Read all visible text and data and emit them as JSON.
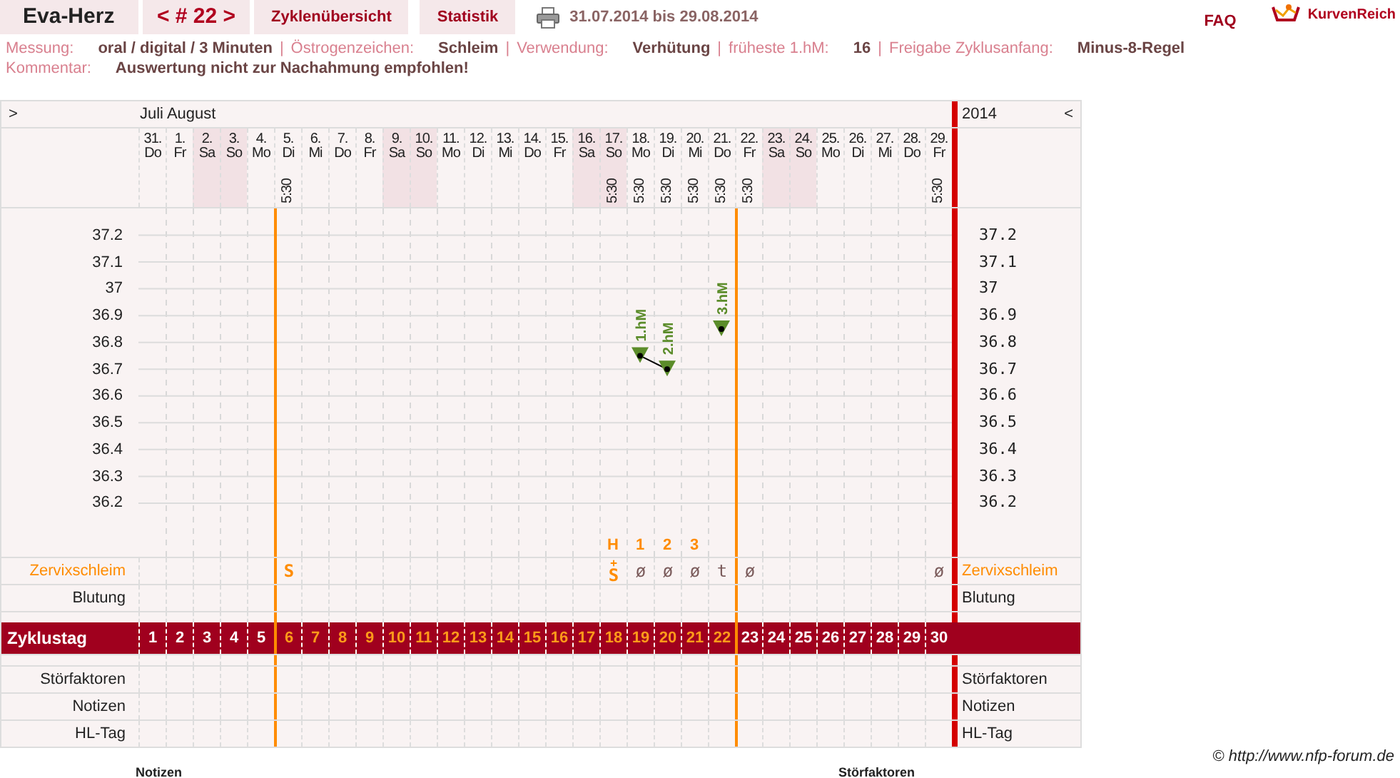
{
  "header": {
    "title": "Eva-Herz",
    "cycle": "< # 22 >",
    "tabs": [
      {
        "label": "Zyklenübersicht"
      },
      {
        "label": "Statistik"
      }
    ],
    "date_range": "31.07.2014 bis 29.08.2014",
    "faq": "FAQ",
    "brand": "KurvenReich"
  },
  "info": [
    [
      {
        "label": "Messung:",
        "value": "oral / digital / 3 Minuten",
        "separator": "|"
      },
      {
        "label": "Östrogenzeichen:",
        "value": "Schleim",
        "separator": "|"
      },
      {
        "label": "Verwendung:",
        "value": "Verhütung",
        "separator": "|"
      },
      {
        "label": "früheste 1.hM:",
        "value": "16",
        "separator": "|"
      },
      {
        "label": "Freigabe Zyklusanfang:",
        "value": "Minus-8-Regel"
      }
    ],
    [
      {
        "label": "Kommentar:",
        "value": "Auswertung nicht zur Nachahmung empfohlen!"
      }
    ]
  ],
  "table": {
    "nav_left": ">",
    "months": "Juli August",
    "year": "2014",
    "nav_right": "<",
    "days": [
      {
        "date": "31.",
        "weekday": "Do",
        "weekend": false,
        "cycle_day": "1",
        "fertile": false,
        "phase_line": false
      },
      {
        "date": "1.",
        "weekday": "Fr",
        "weekend": false,
        "cycle_day": "2",
        "fertile": false,
        "phase_line": false
      },
      {
        "date": "2.",
        "weekday": "Sa",
        "weekend": true,
        "cycle_day": "3",
        "fertile": false,
        "phase_line": false
      },
      {
        "date": "3.",
        "weekday": "So",
        "weekend": true,
        "cycle_day": "4",
        "fertile": false,
        "phase_line": false
      },
      {
        "date": "4.",
        "weekday": "Mo",
        "weekend": false,
        "cycle_day": "5",
        "fertile": false,
        "phase_line": false
      },
      {
        "date": "5.",
        "weekday": "Di",
        "weekend": false,
        "time": "5:30",
        "cycle_day": "6",
        "fertile": true,
        "phase_line": true,
        "mucus": "S",
        "mucus_fertile": true
      },
      {
        "date": "6.",
        "weekday": "Mi",
        "weekend": false,
        "cycle_day": "7",
        "fertile": true,
        "phase_line": false
      },
      {
        "date": "7.",
        "weekday": "Do",
        "weekend": false,
        "cycle_day": "8",
        "fertile": true,
        "phase_line": false
      },
      {
        "date": "8.",
        "weekday": "Fr",
        "weekend": false,
        "cycle_day": "9",
        "fertile": true,
        "phase_line": false
      },
      {
        "date": "9.",
        "weekday": "Sa",
        "weekend": true,
        "cycle_day": "10",
        "fertile": true,
        "phase_line": false
      },
      {
        "date": "10.",
        "weekday": "So",
        "weekend": true,
        "cycle_day": "11",
        "fertile": true,
        "phase_line": false
      },
      {
        "date": "11.",
        "weekday": "Mo",
        "weekend": false,
        "cycle_day": "12",
        "fertile": true,
        "phase_line": false
      },
      {
        "date": "12.",
        "weekday": "Di",
        "weekend": false,
        "cycle_day": "13",
        "fertile": true,
        "phase_line": false
      },
      {
        "date": "13.",
        "weekday": "Mi",
        "weekend": false,
        "cycle_day": "14",
        "fertile": true,
        "phase_line": false
      },
      {
        "date": "14.",
        "weekday": "Do",
        "weekend": false,
        "cycle_day": "15",
        "fertile": true,
        "phase_line": false
      },
      {
        "date": "15.",
        "weekday": "Fr",
        "weekend": false,
        "cycle_day": "16",
        "fertile": true,
        "phase_line": false
      },
      {
        "date": "16.",
        "weekday": "Sa",
        "weekend": true,
        "cycle_day": "17",
        "fertile": true,
        "phase_line": false
      },
      {
        "date": "17.",
        "weekday": "So",
        "weekend": true,
        "time": "5:30",
        "cycle_day": "18",
        "fertile": true,
        "phase_line": false,
        "count_mark": "H",
        "mucus": "S",
        "mucus_note": "+",
        "mucus_fertile": true
      },
      {
        "date": "18.",
        "weekday": "Mo",
        "weekend": false,
        "time": "5:30",
        "cycle_day": "19",
        "fertile": true,
        "phase_line": false,
        "count_mark": "1",
        "mucus": "ø",
        "mucus_fertile": false,
        "temp_label": "1.hM"
      },
      {
        "date": "19.",
        "weekday": "Di",
        "weekend": false,
        "time": "5:30",
        "cycle_day": "20",
        "fertile": true,
        "phase_line": false,
        "count_mark": "2",
        "mucus": "ø",
        "mucus_fertile": false,
        "temp_label": "2.hM"
      },
      {
        "date": "20.",
        "weekday": "Mi",
        "weekend": false,
        "time": "5:30",
        "cycle_day": "21",
        "fertile": true,
        "phase_line": false,
        "count_mark": "3",
        "mucus": "ø",
        "mucus_fertile": false
      },
      {
        "date": "21.",
        "weekday": "Do",
        "weekend": false,
        "time": "5:30",
        "cycle_day": "22",
        "fertile": true,
        "phase_line": false,
        "mucus": "t",
        "mucus_fertile": false,
        "temp_label": "3.hM"
      },
      {
        "date": "22.",
        "weekday": "Fr",
        "weekend": false,
        "time": "5:30",
        "cycle_day": "23",
        "fertile": false,
        "phase_line": true,
        "mucus": "ø",
        "mucus_fertile": false
      },
      {
        "date": "23.",
        "weekday": "Sa",
        "weekend": true,
        "cycle_day": "24",
        "fertile": false,
        "phase_line": false
      },
      {
        "date": "24.",
        "weekday": "So",
        "weekend": true,
        "cycle_day": "25",
        "fertile": false,
        "phase_line": false
      },
      {
        "date": "25.",
        "weekday": "Mo",
        "weekend": false,
        "cycle_day": "26",
        "fertile": false,
        "phase_line": false
      },
      {
        "date": "26.",
        "weekday": "Di",
        "weekend": false,
        "cycle_day": "27",
        "fertile": false,
        "phase_line": false
      },
      {
        "date": "27.",
        "weekday": "Mi",
        "weekend": false,
        "cycle_day": "28",
        "fertile": false,
        "phase_line": false
      },
      {
        "date": "28.",
        "weekday": "Do",
        "weekend": false,
        "cycle_day": "29",
        "fertile": false,
        "phase_line": false
      },
      {
        "date": "29.",
        "weekday": "Fr",
        "weekend": false,
        "time": "5:30",
        "cycle_day": "30",
        "fertile": false,
        "phase_line": false,
        "mucus": "ø",
        "mucus_fertile": false
      }
    ],
    "chart_data": {
      "type": "line",
      "series": [
        {
          "marker": "triangle_down",
          "color": "#5b8c2a",
          "values": [
            null,
            null,
            null,
            null,
            null,
            null,
            null,
            null,
            null,
            null,
            null,
            null,
            null,
            null,
            null,
            null,
            null,
            null,
            36.75,
            36.7,
            null,
            36.85,
            null,
            null,
            null,
            null,
            null,
            null,
            null,
            null
          ]
        }
      ],
      "ylim": [
        36.0,
        37.3
      ],
      "grid": true,
      "yticks": [
        {
          "value": 37.2,
          "label": "37.2"
        },
        {
          "value": 37.1,
          "label": "37.1"
        },
        {
          "value": 37,
          "label": "37"
        },
        {
          "value": 36.9,
          "label": "36.9"
        },
        {
          "value": 36.8,
          "label": "36.8"
        },
        {
          "value": 36.7,
          "label": "36.7"
        },
        {
          "value": 36.6,
          "label": "36.6"
        },
        {
          "value": 36.5,
          "label": "36.5"
        },
        {
          "value": 36.4,
          "label": "36.4"
        },
        {
          "value": 36.3,
          "label": "36.3"
        },
        {
          "value": 36.2,
          "label": "36.2"
        }
      ]
    },
    "right_scale": [
      "37.2",
      "37.1",
      "37",
      "36.9",
      "36.8",
      "36.7",
      "36.6",
      "36.5",
      "36.4",
      "36.3",
      "36.2"
    ],
    "rows": [
      {
        "kind": "mucus",
        "label": "Zervixschleim",
        "label_right": "Zervixschleim"
      },
      {
        "kind": "plain",
        "label": "Blutung",
        "label_right": "Blutung"
      },
      {
        "kind": "spacer"
      },
      {
        "kind": "cycle_day",
        "label": "Zyklustag"
      },
      {
        "kind": "spacer"
      },
      {
        "kind": "plain",
        "label": "Störfaktoren",
        "label_right": "Störfaktoren"
      },
      {
        "kind": "plain",
        "label": "Notizen",
        "label_right": "Notizen"
      },
      {
        "kind": "plain",
        "label": "HL-Tag",
        "label_right": "HL-Tag"
      }
    ]
  },
  "copyright": "© http://www.nfp-forum.de",
  "footer_headings": [
    "Notizen",
    "Störfaktoren"
  ]
}
